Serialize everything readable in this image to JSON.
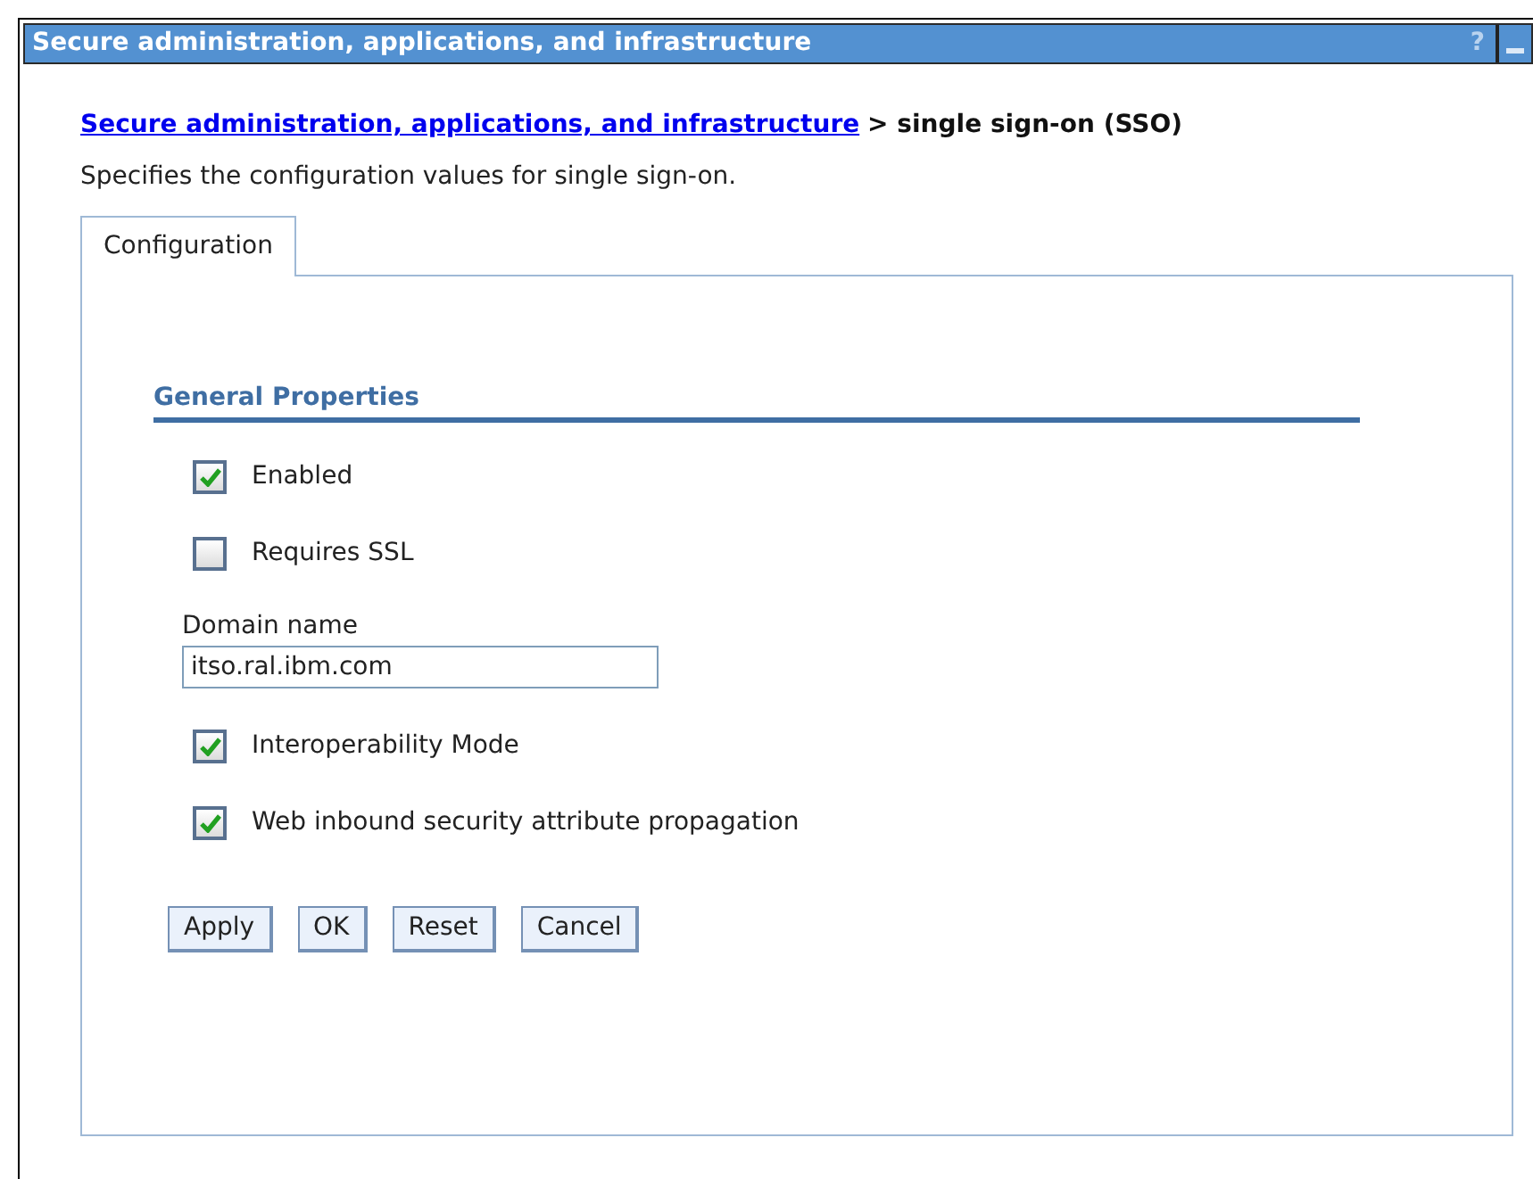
{
  "window": {
    "title": "Secure administration, applications, and infrastructure",
    "help": "?"
  },
  "breadcrumb": {
    "link": "Secure administration, applications, and infrastructure",
    "current": "> single sign-on (SSO)"
  },
  "description": "Specifies the configuration values for single sign-on.",
  "tabs": [
    {
      "label": "Configuration",
      "selected": true
    }
  ],
  "section": {
    "title": "General Properties"
  },
  "fields": [
    {
      "kind": "checkbox",
      "label": "Enabled",
      "checked": true
    },
    {
      "kind": "checkbox",
      "label": "Requires SSL",
      "checked": false
    },
    {
      "kind": "text",
      "label": "Domain name",
      "value": "itso.ral.ibm.com"
    },
    {
      "kind": "checkbox",
      "label": "Interoperability Mode",
      "checked": true
    },
    {
      "kind": "checkbox",
      "label": "Web inbound security attribute propagation",
      "checked": true
    }
  ],
  "buttons": [
    "Apply",
    "OK",
    "Reset",
    "Cancel"
  ]
}
